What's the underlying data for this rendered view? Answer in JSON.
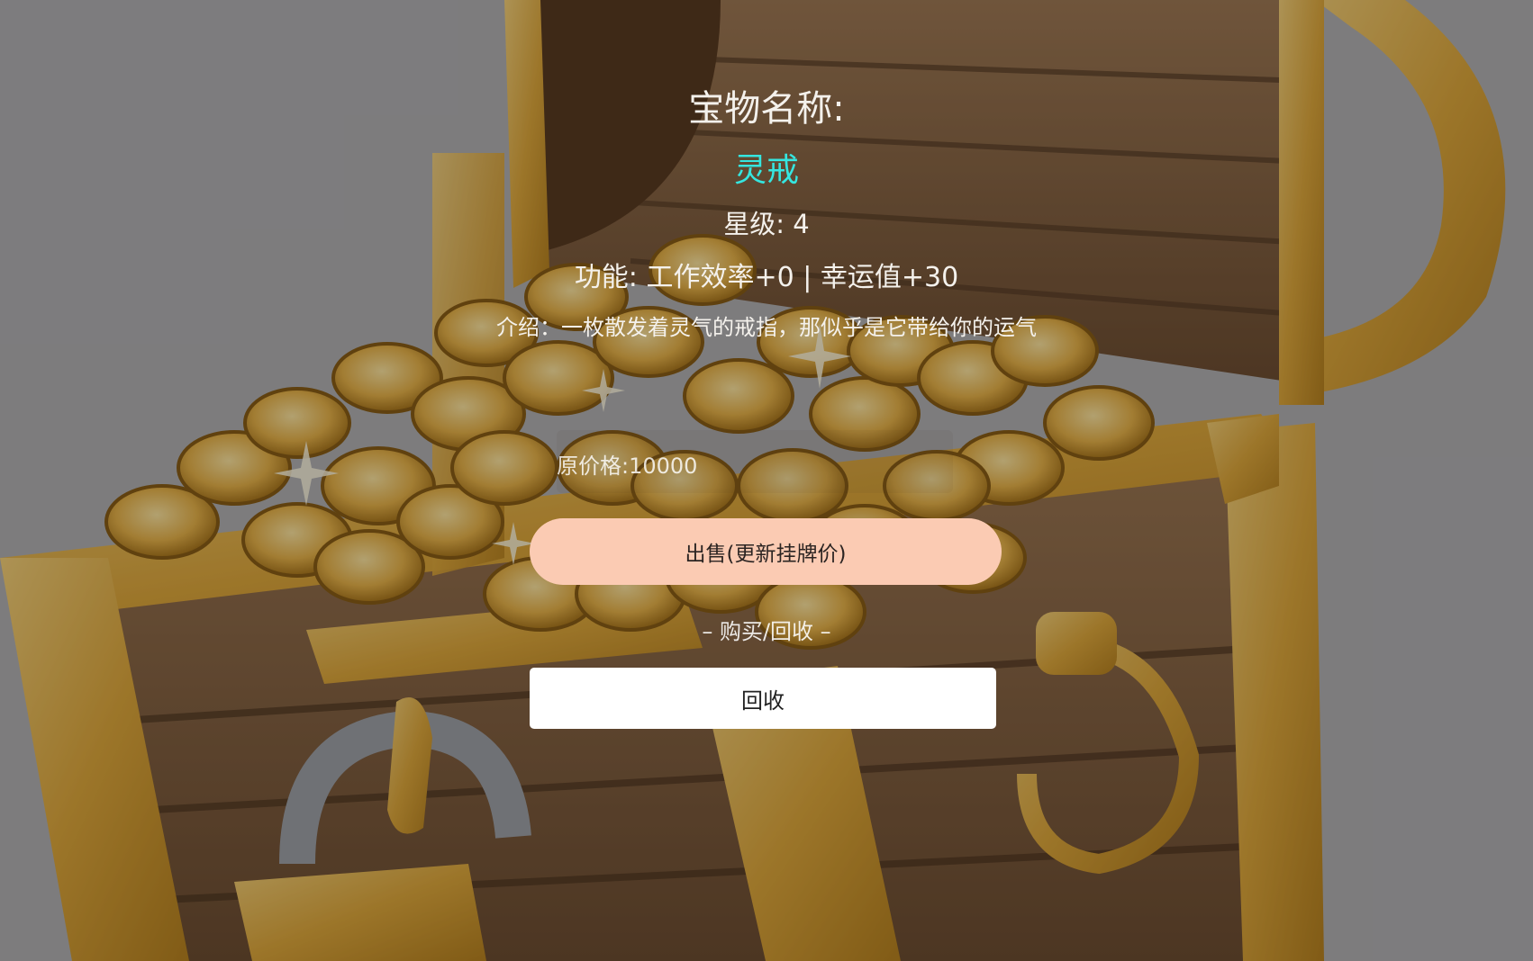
{
  "treasure": {
    "title_label": "宝物名称:",
    "name": "灵戒",
    "star_text": "星级: 4",
    "function_text": "功能: 工作效率+0 | 幸运值+30",
    "intro_text": "介绍：一枚散发着灵气的戒指，那似乎是它带给你的运气"
  },
  "sell": {
    "price_placeholder": "原价格:10000",
    "sell_button_label": "出售(更新挂牌价)"
  },
  "divider": {
    "label": "– 购买/回收 –"
  },
  "recycle": {
    "button_label": "回收"
  },
  "colors": {
    "name_accent": "#35e6e0",
    "sell_button_bg": "#fbcbb3",
    "recycle_button_bg": "#ffffff"
  },
  "background": {
    "icon": "treasure-chest-illustration"
  }
}
